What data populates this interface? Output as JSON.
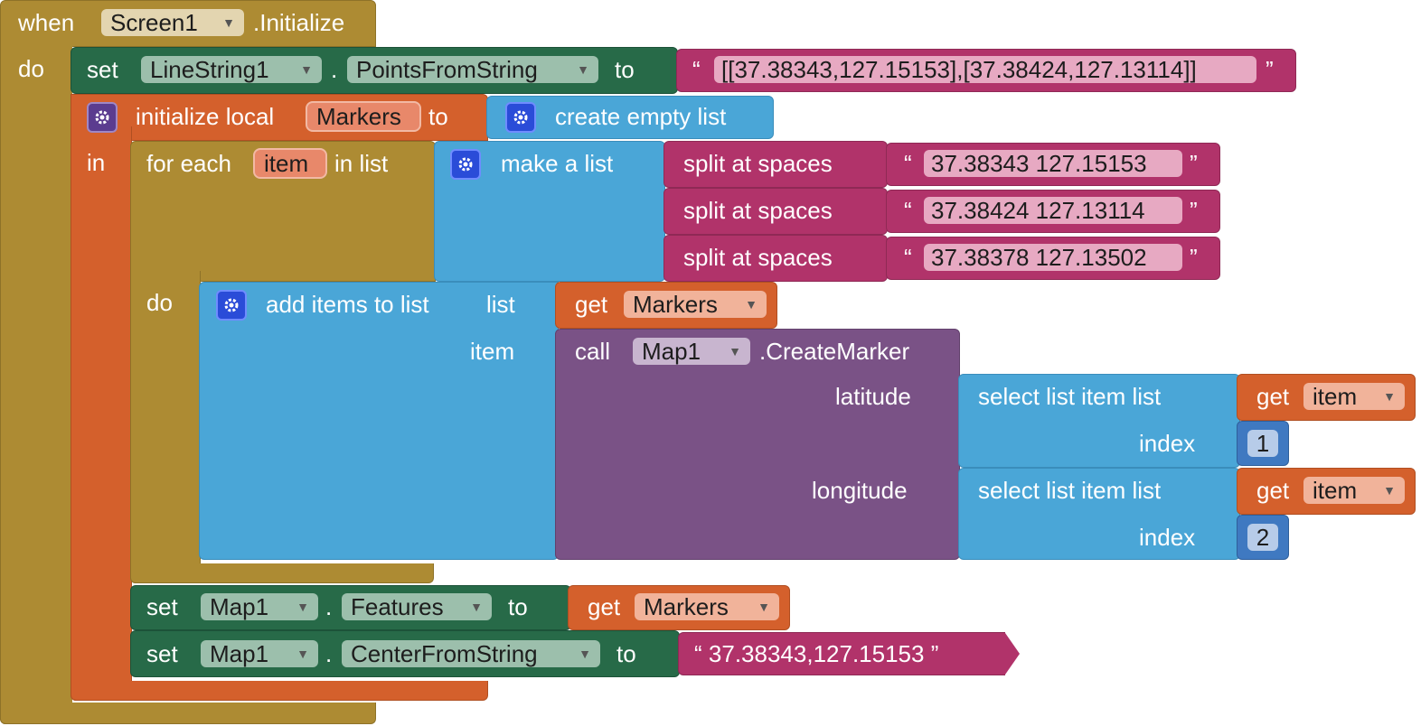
{
  "event": {
    "when_label": "when",
    "component": "Screen1",
    "event_name": ".Initialize",
    "do_label": "do"
  },
  "set_linestring": {
    "set_label": "set",
    "component": "LineString1",
    "dot": ".",
    "property": "PointsFromString",
    "to_label": "to",
    "value": "[[37.38343,127.15153],[37.38424,127.13114]]"
  },
  "init_local": {
    "label": "initialize local",
    "var_name": "Markers",
    "to_label": "to",
    "in_label": "in",
    "create_empty_list": "create empty list"
  },
  "for_each": {
    "for_each_label": "for each",
    "var_name": "item",
    "in_list_label": "in list",
    "do_label": "do",
    "make_a_list": "make a list",
    "split_label": "split at spaces",
    "strings": [
      "37.38343 127.15153",
      "37.38424 127.13114",
      "37.38378 127.13502"
    ]
  },
  "add_items": {
    "label": "add items to list",
    "list_label": "list",
    "item_label": "item",
    "get_label": "get",
    "get_var": "Markers"
  },
  "create_marker": {
    "call_label": "call",
    "component": "Map1",
    "method": ".CreateMarker",
    "latitude_label": "latitude",
    "longitude_label": "longitude",
    "select_label": "select list item  list",
    "index_label": "index",
    "get_label": "get",
    "get_var": "item",
    "lat_index": "1",
    "lon_index": "2"
  },
  "set_features": {
    "set_label": "set",
    "component": "Map1",
    "dot": ".",
    "property": "Features",
    "to_label": "to",
    "get_label": "get",
    "get_var": "Markers"
  },
  "set_center": {
    "set_label": "set",
    "component": "Map1",
    "dot": ".",
    "property": "CenterFromString",
    "to_label": "to",
    "value": "37.38343,127.15153"
  },
  "quote_open": "“",
  "quote_close": "”",
  "colors": {
    "event": "#ad8b33",
    "setter": "#276a48",
    "variable": "#d4602c",
    "list": "#4aa6d7",
    "component_call": "#7a5286",
    "text": "#b1336a",
    "math": "#3f79c1"
  }
}
